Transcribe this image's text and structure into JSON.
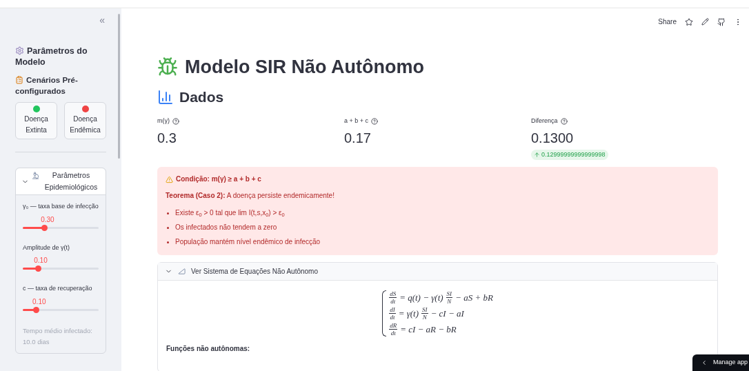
{
  "sidebar": {
    "collapse": "«",
    "title": "Parâmetros do Modelo",
    "scenarios_title": "Cenários Pré-configurados",
    "scenarios": [
      {
        "label": "Doença Extinta",
        "color": "#22c55e"
      },
      {
        "label": "Doença Endêmica",
        "color": "#ef4444"
      }
    ],
    "expander": {
      "title": "Parâmetros Epidemiológicos",
      "expanded": true,
      "sliders": [
        {
          "label": "γ₀ — taxa base de infecção",
          "value": "0.30",
          "level": 0.29
        },
        {
          "label": "Amplitude de γ(t)",
          "value": "0.10",
          "level": 0.2
        },
        {
          "label": "c — taxa de recuperação",
          "value": "0.10",
          "level": 0.18
        }
      ],
      "caption": "Tempo médio infectado: 10.0 dias"
    }
  },
  "toolbar": {
    "share": "Share"
  },
  "title": "Modelo SIR Não Autônomo",
  "section": "Dados",
  "metrics": [
    {
      "label": "m(γ)",
      "value": "0.3"
    },
    {
      "label": "a + b + c",
      "value": "0.17"
    },
    {
      "label": "Diferença",
      "value": "0.1300",
      "delta": "0.12999999999999998"
    }
  ],
  "alert": {
    "heading": "Condição: m(γ) ≥ a + b + c",
    "theorem": "**Teorema (Caso 2):** A doença persiste endemicamente!",
    "bullets": [
      "Existe ε$_{0}$ > 0 tal que lim I(t,s,x$_{0}$) > ε$_{0}$",
      "Os infectados não tendem a zero",
      "População mantém nível endêmico de infecção"
    ]
  },
  "equations": {
    "title": "Ver Sistema de Equações Não Autônomo",
    "expanded": true,
    "lines": [
      [
        {
          "kind": "frac",
          "num": "dS",
          "den": "dt"
        },
        {
          "kind": "text",
          "text": "= q(t) − γ(t)"
        },
        {
          "kind": "frac",
          "num": "SI",
          "den": "N"
        },
        {
          "kind": "text",
          "text": "− aS + bR"
        }
      ],
      [
        {
          "kind": "frac",
          "num": "dI",
          "den": "dt"
        },
        {
          "kind": "text",
          "text": "= γ(t)"
        },
        {
          "kind": "frac",
          "num": "SI",
          "den": "N"
        },
        {
          "kind": "text",
          "text": "− cI − aI"
        }
      ],
      [
        {
          "kind": "frac",
          "num": "dR",
          "den": "dt"
        },
        {
          "kind": "text",
          "text": "= cI − aR − bR"
        }
      ]
    ],
    "subheading": "Funções não autônomas:"
  },
  "manage": "Manage app"
}
